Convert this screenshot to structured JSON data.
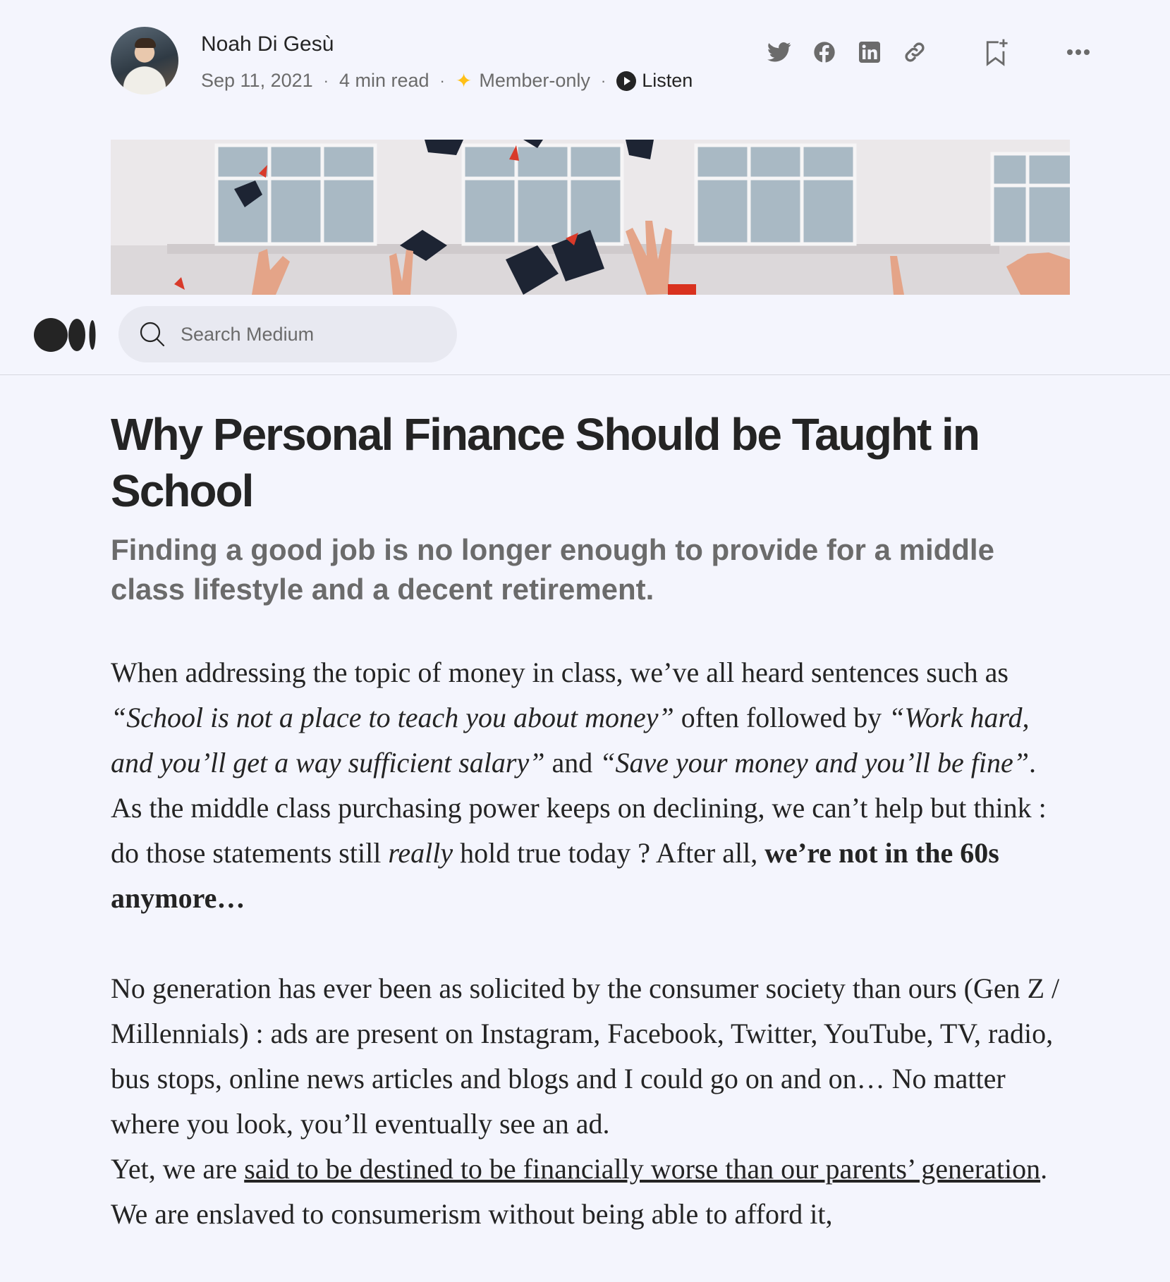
{
  "author": {
    "name": "Noah Di Gesù",
    "date": "Sep 11, 2021",
    "read_time": "4 min read",
    "member_label": "Member-only",
    "listen_label": "Listen"
  },
  "icons": {
    "share": [
      "twitter-icon",
      "facebook-icon",
      "linkedin-icon",
      "link-icon"
    ],
    "bookmark": "bookmark-add-icon",
    "more": "more-icon",
    "search": "search-icon",
    "logo": "medium-logo"
  },
  "nav": {
    "search_placeholder": "Search Medium"
  },
  "article": {
    "title": "Why Personal Finance Should be Taught in School",
    "subtitle": "Finding a good job is no longer enough to provide for a middle class lifestyle and a decent retirement.",
    "p1": {
      "t1": "When addressing the topic of money in class, we’ve all heard sentences such as ",
      "q1": "“School is not a place to teach you about money”",
      "t2": " often followed by ",
      "q2": "“Work hard, and you’ll get a way sufficient salary”",
      "t3": " and ",
      "q3": "“Save your money and you’ll be fine”",
      "t4": "."
    },
    "p2": {
      "t1": "As the middle class purchasing power keeps on declining, we can’t help but think : do those statements still ",
      "em": "really",
      "t2": " hold true today ? After all, ",
      "strong": "we’re not in the 60s anymore…"
    },
    "p3": {
      "t1": "No generation has ever been as solicited by the consumer society than ours (Gen Z / Millennials) : ads are present on Instagram, Facebook, Twitter, YouTube, TV, radio, bus stops, online news articles and blogs and I could go on and on… No matter where you look, you’ll eventually see an ad."
    },
    "p4": {
      "t1": "Yet, we are ",
      "link": "said to be destined to be financially worse than our parents’ generation",
      "t2": ". We are enslaved to consumerism without being able to afford it,"
    }
  },
  "colors": {
    "background": "#f4f5fd",
    "text": "#242424",
    "muted": "#6b6b6b",
    "member_star": "#ffc017"
  }
}
